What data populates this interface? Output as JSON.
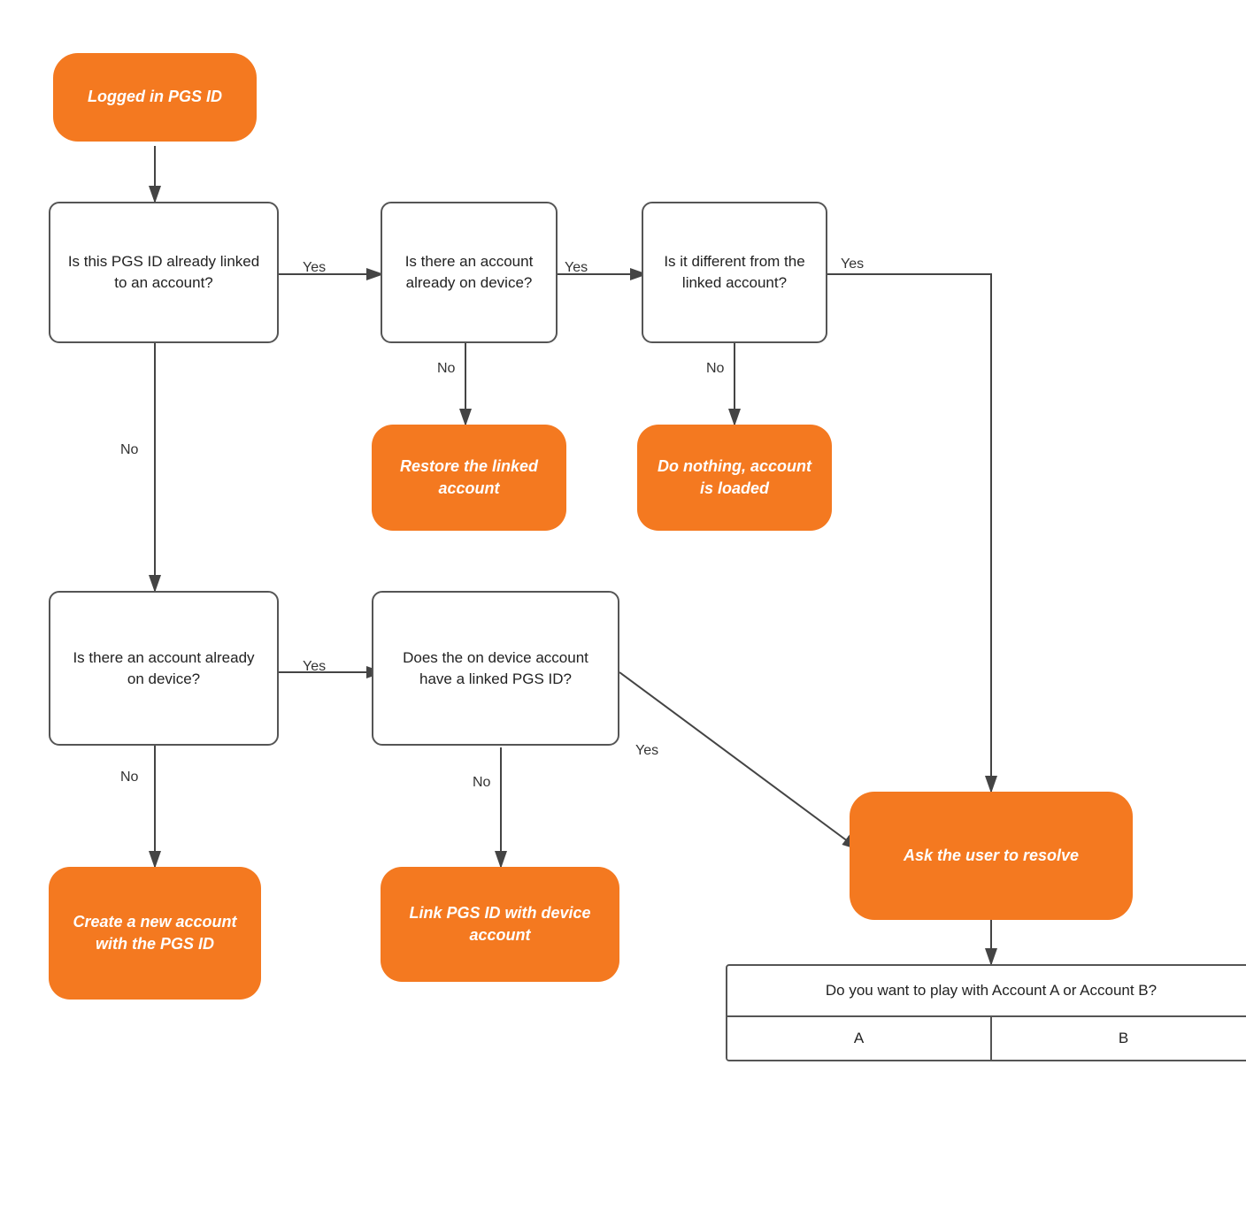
{
  "nodes": {
    "start": {
      "label": "Logged in PGS ID",
      "type": "orange"
    },
    "q1": {
      "label": "Is this PGS ID already linked to an account?",
      "type": "rect"
    },
    "q2": {
      "label": "Is there an account already on device?",
      "type": "rect"
    },
    "q3": {
      "label": "Is it different from the linked account?",
      "type": "rect"
    },
    "a_restore": {
      "label": "Restore the linked account",
      "type": "orange"
    },
    "a_donothing": {
      "label": "Do nothing, account is loaded",
      "type": "orange"
    },
    "q4": {
      "label": "Is there an account already on device?",
      "type": "rect"
    },
    "q5": {
      "label": "Does the on device account have a linked PGS ID?",
      "type": "rect"
    },
    "a_create": {
      "label": "Create a new account with the PGS  ID",
      "type": "orange"
    },
    "a_link": {
      "label": "Link PGS ID with device account",
      "type": "orange"
    },
    "a_resolve": {
      "label": "Ask the user to resolve",
      "type": "orange"
    }
  },
  "labels": {
    "yes1": "Yes",
    "yes2": "Yes",
    "yes3": "Yes",
    "no1": "No",
    "no2": "No",
    "no3": "No",
    "no4": "No",
    "yes4": "Yes",
    "yes5": "Yes"
  },
  "dialog": {
    "question": "Do you want to play with Account A or Account B?",
    "btn_a": "A",
    "btn_b": "B"
  }
}
